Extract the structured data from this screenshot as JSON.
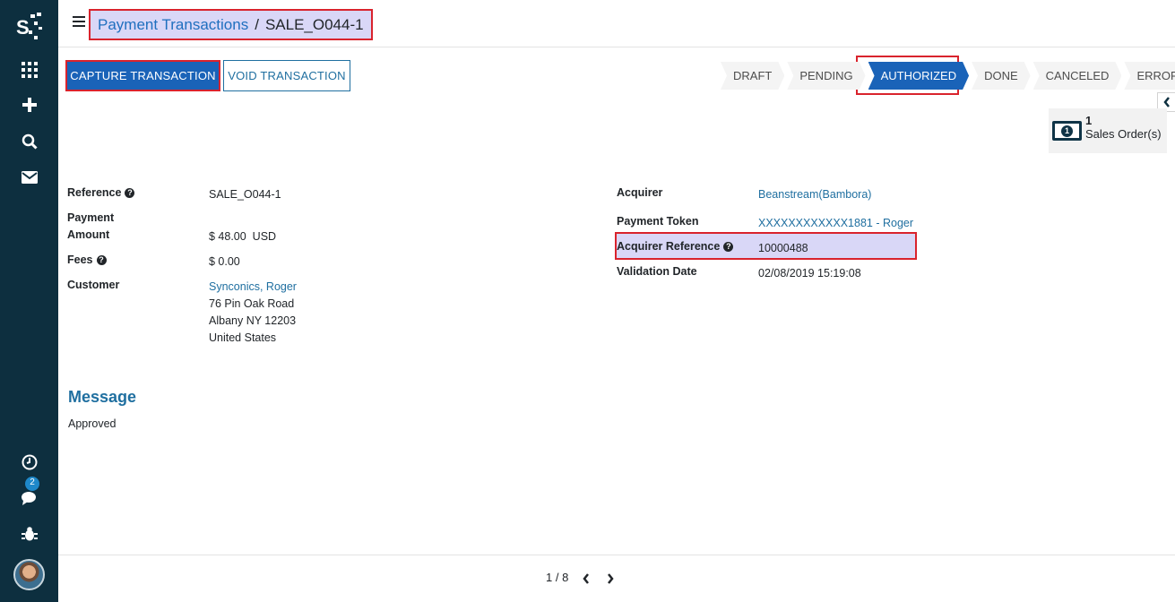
{
  "sidebar": {
    "items": [
      "apps-icon",
      "plus-icon",
      "search-icon",
      "mail-icon"
    ],
    "bottom": [
      "clock-icon",
      "chat-icon",
      "bug-icon"
    ],
    "chat_badge": "2"
  },
  "breadcrumb": {
    "parent": "Payment Transactions",
    "separator": "/",
    "current": "SALE_O044-1"
  },
  "actions": {
    "capture": "CAPTURE TRANSACTION",
    "void": "VOID TRANSACTION"
  },
  "statusbar": {
    "stages": [
      "DRAFT",
      "PENDING",
      "AUTHORIZED",
      "DONE",
      "CANCELED",
      "ERROR"
    ],
    "active": "AUTHORIZED"
  },
  "smart_button": {
    "count": "1",
    "label": "Sales Order(s)"
  },
  "fields": {
    "reference_label": "Reference",
    "reference_value": "SALE_O044-1",
    "payment_amount_label_1": "Payment",
    "payment_amount_label_2": "Amount",
    "payment_amount_value": "$ 48.00",
    "currency": "USD",
    "fees_label": "Fees",
    "fees_value": "$ 0.00",
    "customer_label": "Customer",
    "customer_name": "Synconics, Roger",
    "customer_street": "76 Pin Oak Road",
    "customer_city": "Albany NY 12203",
    "customer_country": "United States",
    "acquirer_label": "Acquirer",
    "acquirer_value": "Beanstream(Bambora)",
    "token_label": "Payment Token",
    "token_value": "XXXXXXXXXXXX1881 - Roger",
    "acq_ref_label": "Acquirer Reference",
    "acq_ref_value": "10000488",
    "validation_label": "Validation Date",
    "validation_value": "02/08/2019 15:19:08"
  },
  "message": {
    "title": "Message",
    "text": "Approved"
  },
  "pager": {
    "value": "1 / 8"
  },
  "colors": {
    "sidebar": "#0d2f3f",
    "primary": "#1a63b8",
    "link": "#1f6fa0",
    "highlight_fill": "#d9d7f7",
    "highlight_border": "#d9232d"
  }
}
